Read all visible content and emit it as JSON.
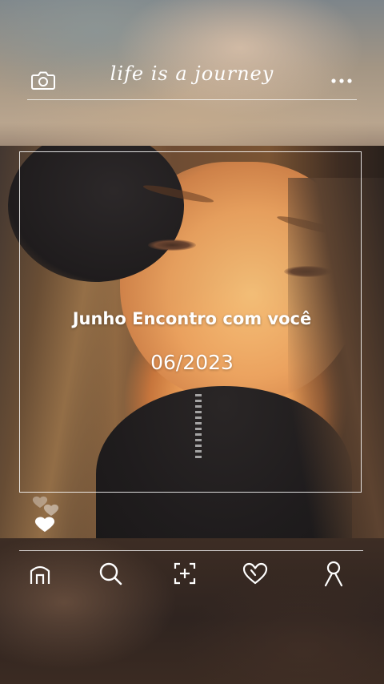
{
  "header": {
    "title": "life is a journey",
    "left_icon": "camera-icon",
    "right_icon": "more-icon"
  },
  "post": {
    "title": "Junho Encontro com você",
    "date": "06/2023"
  },
  "nav": {
    "items": [
      {
        "icon": "home-icon"
      },
      {
        "icon": "search-icon"
      },
      {
        "icon": "add-post-icon"
      },
      {
        "icon": "heart-icon"
      },
      {
        "icon": "profile-icon"
      }
    ]
  },
  "colors": {
    "text": "#ffffff",
    "divider": "#ffffff"
  }
}
